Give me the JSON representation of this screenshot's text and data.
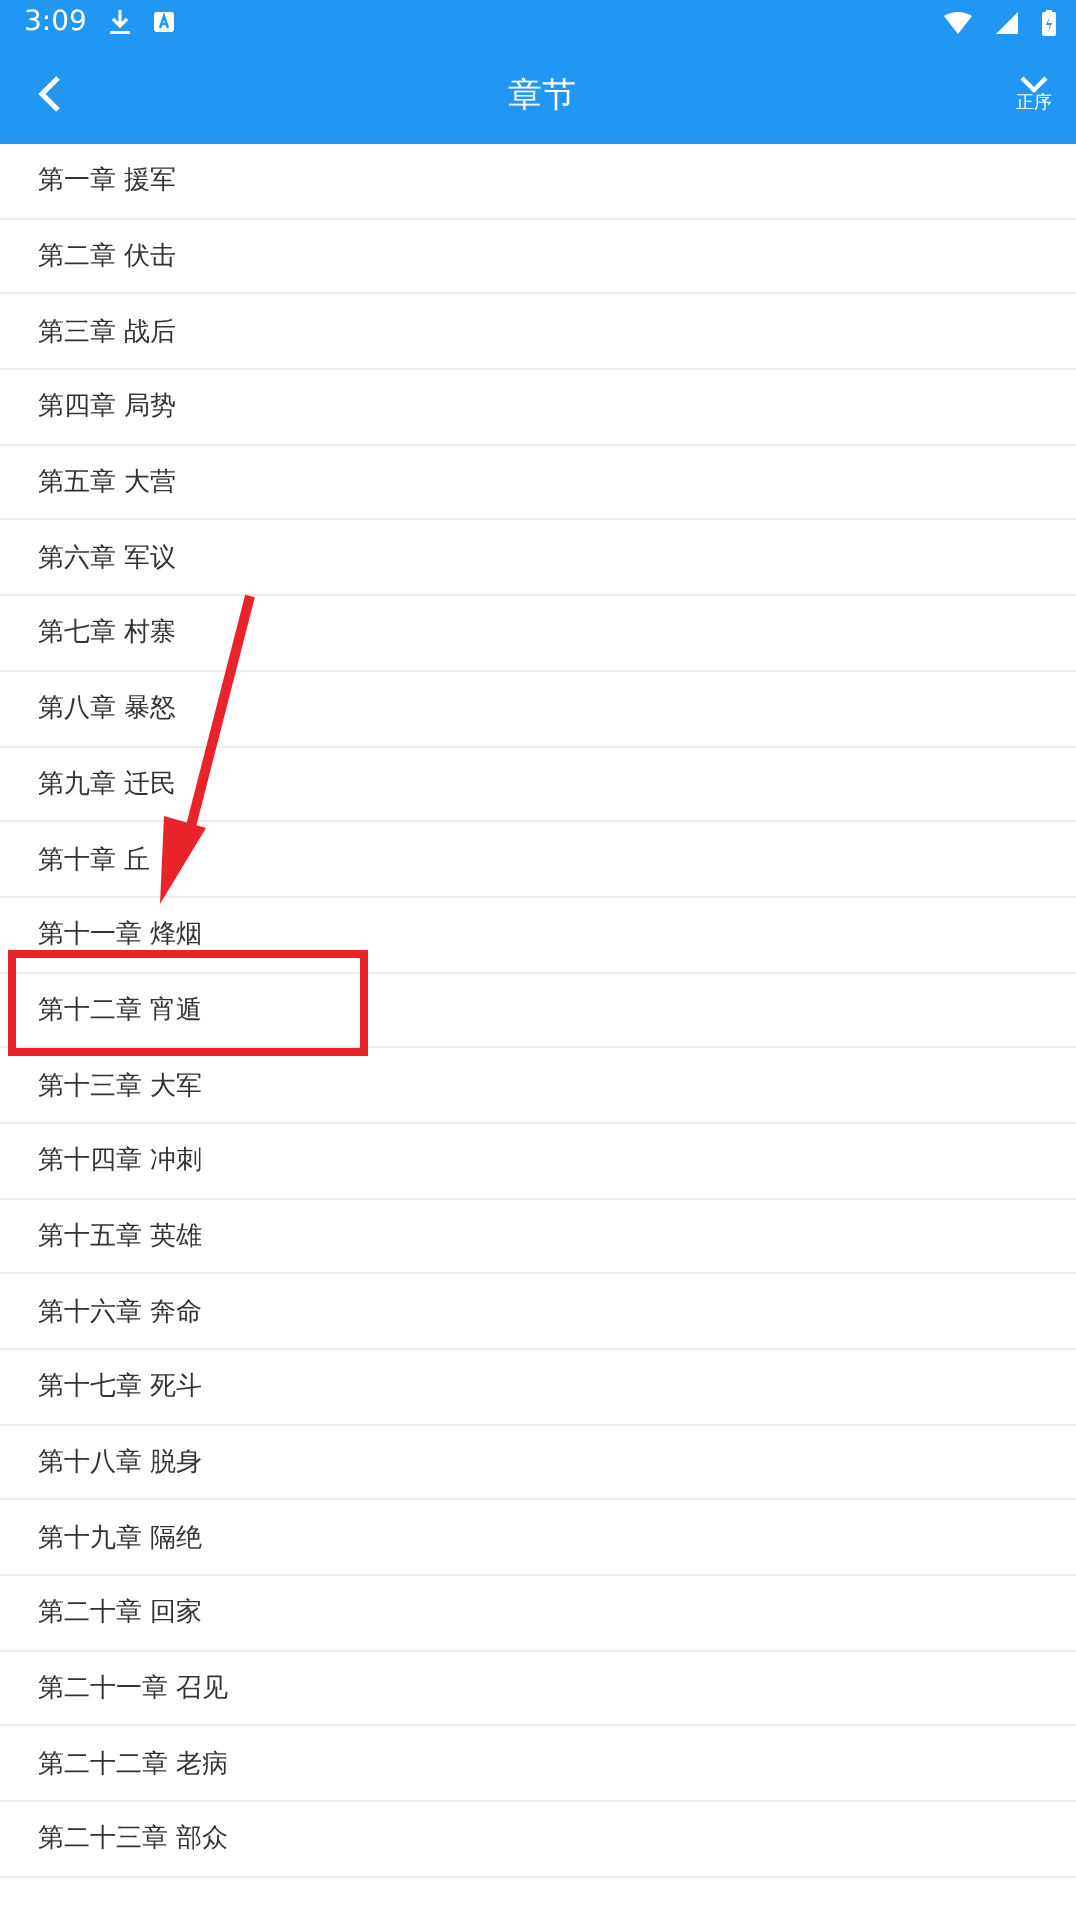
{
  "status_bar": {
    "time": "3:09"
  },
  "app_bar": {
    "title": "章节",
    "sort_label": "正序"
  },
  "chapters": [
    {
      "title": "第一章 援军",
      "highlighted": false
    },
    {
      "title": "第二章 伏击",
      "highlighted": false
    },
    {
      "title": "第三章 战后",
      "highlighted": false
    },
    {
      "title": "第四章 局势",
      "highlighted": false
    },
    {
      "title": "第五章 大营",
      "highlighted": false
    },
    {
      "title": "第六章 军议",
      "highlighted": false
    },
    {
      "title": "第七章 村寨",
      "highlighted": false
    },
    {
      "title": "第八章 暴怒",
      "highlighted": false
    },
    {
      "title": "第九章 迁民",
      "highlighted": false
    },
    {
      "title": "第十章 丘",
      "highlighted": false
    },
    {
      "title": "第十一章 烽烟",
      "highlighted": false
    },
    {
      "title": "第十二章 宵遁",
      "highlighted": true
    },
    {
      "title": "第十三章 大军",
      "highlighted": false
    },
    {
      "title": "第十四章 冲刺",
      "highlighted": false
    },
    {
      "title": "第十五章 英雄",
      "highlighted": false
    },
    {
      "title": "第十六章 奔命",
      "highlighted": false
    },
    {
      "title": "第十七章 死斗",
      "highlighted": false
    },
    {
      "title": "第十八章 脱身",
      "highlighted": false
    },
    {
      "title": "第十九章 隔绝",
      "highlighted": false
    },
    {
      "title": "第二十章 回家",
      "highlighted": false
    },
    {
      "title": "第二十一章 召见",
      "highlighted": false
    },
    {
      "title": "第二十二章 老病",
      "highlighted": false
    },
    {
      "title": "第二十三章 部众",
      "highlighted": false
    }
  ]
}
